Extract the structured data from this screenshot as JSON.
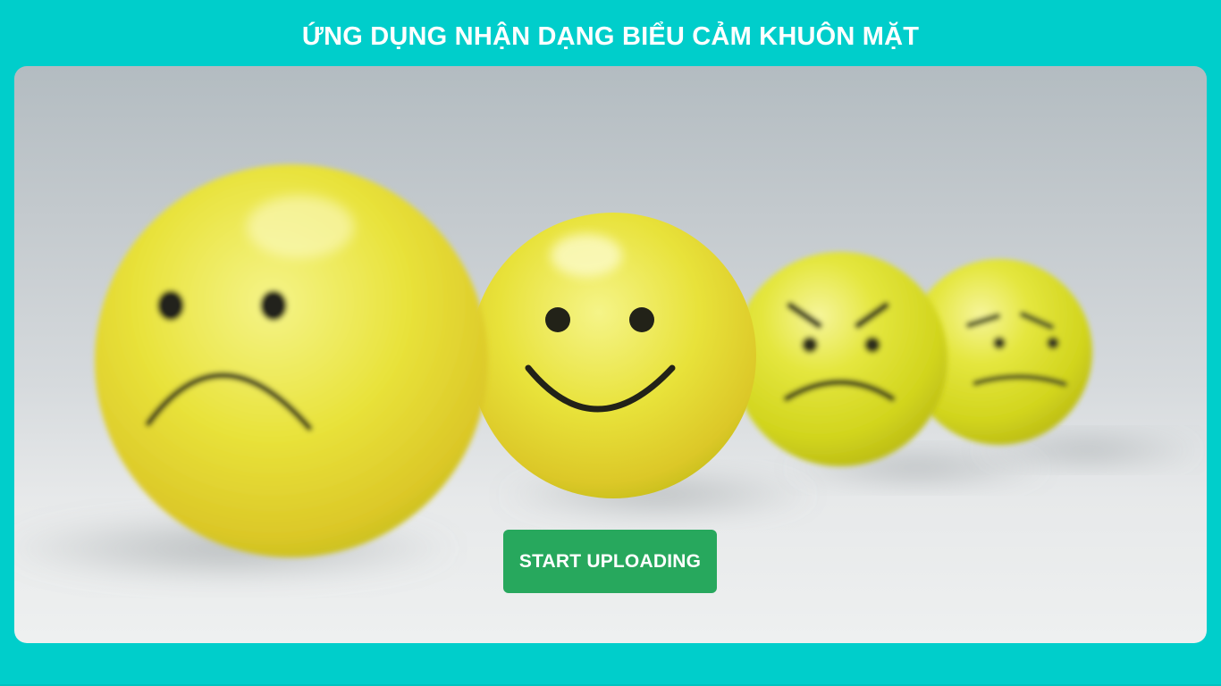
{
  "header": {
    "title": "ỨNG DỤNG NHẬN DẠNG BIỂU CẢM KHUÔN MẶT"
  },
  "hero": {
    "image_subject": "four yellow emoji balls: sad, happy, angry, worried",
    "faces": [
      "sad-face",
      "happy-face",
      "angry-face",
      "worried-face"
    ]
  },
  "actions": {
    "upload_label": "START UPLOADING"
  },
  "colors": {
    "background": "#00cecb",
    "button": "#27a85d",
    "title_text": "#ffffff",
    "emoji": "#dfe43a"
  }
}
